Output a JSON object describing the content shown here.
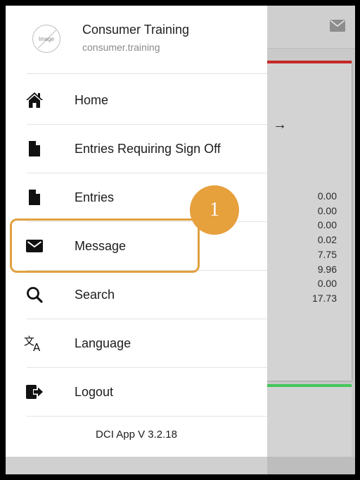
{
  "profile": {
    "avatar_placeholder": "Image",
    "name": "Consumer Training",
    "username": "consumer.training"
  },
  "menu": {
    "items": [
      {
        "label": "Home",
        "icon": "home-icon"
      },
      {
        "label": "Entries Requiring Sign Off",
        "icon": "document-icon"
      },
      {
        "label": "Entries",
        "icon": "document-icon"
      },
      {
        "label": "Message",
        "icon": "envelope-icon"
      },
      {
        "label": "Search",
        "icon": "search-icon"
      },
      {
        "label": "Language",
        "icon": "translate-icon"
      },
      {
        "label": "Logout",
        "icon": "logout-icon"
      }
    ]
  },
  "app_version": "DCI App V 3.2.18",
  "background": {
    "arrow": "→",
    "values": [
      "0.00",
      "0.00",
      "0.00",
      "0.02",
      "7.75",
      "9.96",
      "0.00",
      "17.73"
    ],
    "top_card_accent": "#c62828",
    "bottom_card_accent": "#43c65a"
  },
  "annotation": {
    "step_number": "1",
    "color": "#e6a03c"
  }
}
